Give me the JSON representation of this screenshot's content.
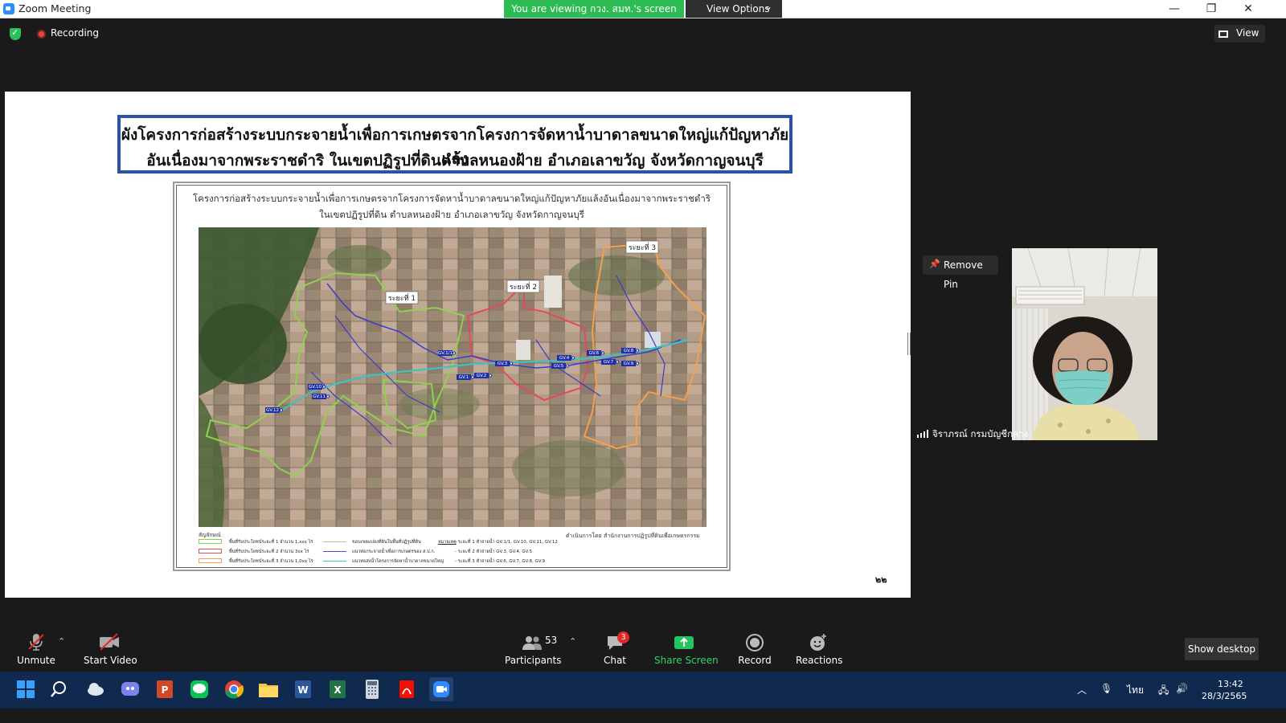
{
  "window": {
    "title": "Zoom Meeting",
    "viewing_banner": "You are viewing กวง. สมท.'s screen",
    "view_options_label": "View Options",
    "minimize": "—",
    "maximize": "❐",
    "close": "✕"
  },
  "meeting_bar": {
    "recording_label": "Recording",
    "view_label": "View"
  },
  "slide": {
    "title_line_1": "ผังโครงการก่อสร้างระบบกระจายน้ำเพื่อการเกษตรจากโครงการจัดหาน้ำบาดาลขนาดใหญ่แก้ปัญหาภัยแล้ง",
    "title_line_2": "อันเนื่องมาจากพระราชดำริ ในเขตปฏิรูปที่ดินตำบลหนองฝ้าย อำเภอเลาขวัญ จังหวัดกาญจนบุรี",
    "map_heading_1": "โครงการก่อสร้างระบบกระจายน้ำเพื่อการเกษตรจากโครงการจัดหาน้ำบาดาลขนาดใหญ่แก้ปัญหาภัยแล้งอันเนื่องมาจากพระราชดำริ",
    "map_heading_2": "ในเขตปฏิรูปที่ดิน ตำบลหนองฝ้าย อำเภอเลาขวัญ จังหวัดกาญจนบุรี",
    "phase_labels": [
      "ระยะที่ 1",
      "ระยะที่ 2",
      "ระยะที่ 3"
    ],
    "gate_labels": [
      "GV.1",
      "GV.2",
      "GV.3",
      "GV.4",
      "GV.5",
      "GV.6",
      "GV.7",
      "GV.8",
      "GV.9",
      "GV.10",
      "GV.11",
      "GV.12",
      "GV.1/1"
    ],
    "legend_title": "สัญลักษณ์",
    "legend_areas": [
      {
        "text": "พื้นที่รับประโยชน์ระยะที่ 1 จำนวน 1,xxx ไร่",
        "color": "#8fd14f"
      },
      {
        "text": "พื้นที่รับประโยชน์ระยะที่ 2 จำนวน 3xx ไร่",
        "color": "#e34b5a"
      },
      {
        "text": "พื้นที่รับประโยชน์ระยะที่ 3 จำนวน 1,0xx ไร่",
        "color": "#f5a04a"
      }
    ],
    "legend_lines": [
      {
        "text": "ขอบเขตแปลงที่ดินในพื้นที่ปฏิรูปที่ดิน",
        "color": "#b9b9b9"
      },
      {
        "text": "แนวท่อกระจายน้ำเพื่อการเกษตรของ ส.ป.ก.",
        "color": "#5050c8"
      },
      {
        "text": "แนวท่อส่งน้ำโครงการจัดหาน้ำบาดาลขนาดใหญ่",
        "color": "#40c0c0"
      }
    ],
    "legend_gates_title": "หมายเหตุ",
    "legend_gates": [
      "- ระยะที่ 1 หัวจ่ายน้ำ GV.1/1, GV.10, GV.11, GV.12",
      "- ระยะที่ 2 หัวจ่ายน้ำ GV.3, GV.4, GV.5",
      "- ระยะที่ 3 หัวจ่ายน้ำ GV.6, GV.7, GV.8, GV.9"
    ],
    "credit": "ดำเนินการโดย สำนักงานการปฏิรูปที่ดินเพื่อเกษตรกรรม",
    "page_number": "๒๒"
  },
  "participant_panel": {
    "remove_pin_label": "Remove Pin",
    "participant_name": "จิราภรณ์ กรมบัญชีกลาง"
  },
  "toolbar": {
    "unmute": "Unmute",
    "start_video": "Start Video",
    "participants": "Participants",
    "participants_count": "53",
    "chat": "Chat",
    "chat_badge": "3",
    "share_screen": "Share Screen",
    "record": "Record",
    "reactions": "Reactions",
    "show_desktop": "Show desktop"
  },
  "taskbar": {
    "language": "ไทย",
    "time": "13:42",
    "date": "28/3/2565"
  },
  "colors": {
    "zoom_blue": "#2d8cff",
    "banner_green": "#2dbb54",
    "share_green": "#22c55e",
    "badge_red": "#e02828",
    "title_border_blue": "#2c52a0",
    "taskbar_navy": "#10294e"
  }
}
